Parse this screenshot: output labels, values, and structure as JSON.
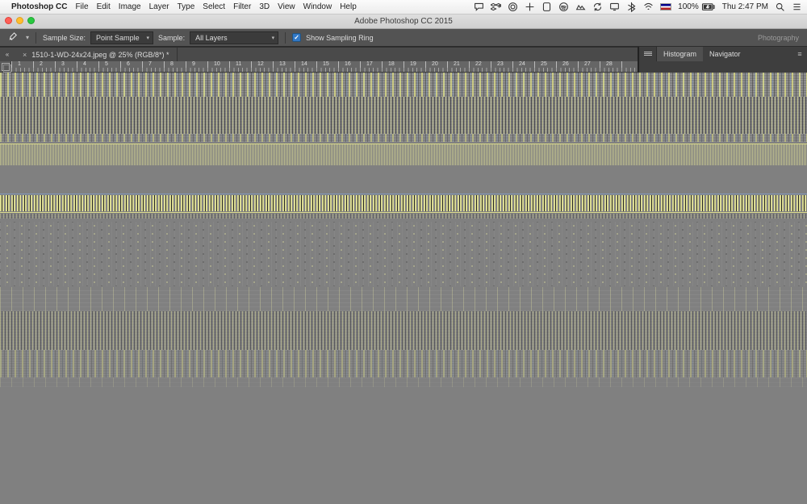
{
  "mac": {
    "app_name": "Photoshop CC",
    "menus": [
      "File",
      "Edit",
      "Image",
      "Layer",
      "Type",
      "Select",
      "Filter",
      "3D",
      "View",
      "Window",
      "Help"
    ],
    "battery": "100%",
    "clock": "Thu 2:47 PM",
    "status_icons": [
      "chat-icon",
      "dropbox-icon",
      "cc-icon",
      "plus-icon",
      "evernote-icon",
      "spotify-icon",
      "finder-icon",
      "sync-icon",
      "display-icon",
      "bluetooth-icon",
      "wifi-icon"
    ]
  },
  "window": {
    "title": "Adobe Photoshop CC 2015"
  },
  "options": {
    "sample_size_label": "Sample Size:",
    "sample_size_value": "Point Sample",
    "sample_label": "Sample:",
    "sample_value": "All Layers",
    "show_ring_label": "Show Sampling Ring",
    "workspace": "Photography"
  },
  "document": {
    "tab_title": "1510-1-WD-24x24.jpeg @ 25% (RGB/8*) *"
  },
  "panels": {
    "tabs": [
      "Histogram",
      "Navigator"
    ],
    "active": "Histogram"
  },
  "ruler": {
    "start": 1,
    "end": 28
  }
}
